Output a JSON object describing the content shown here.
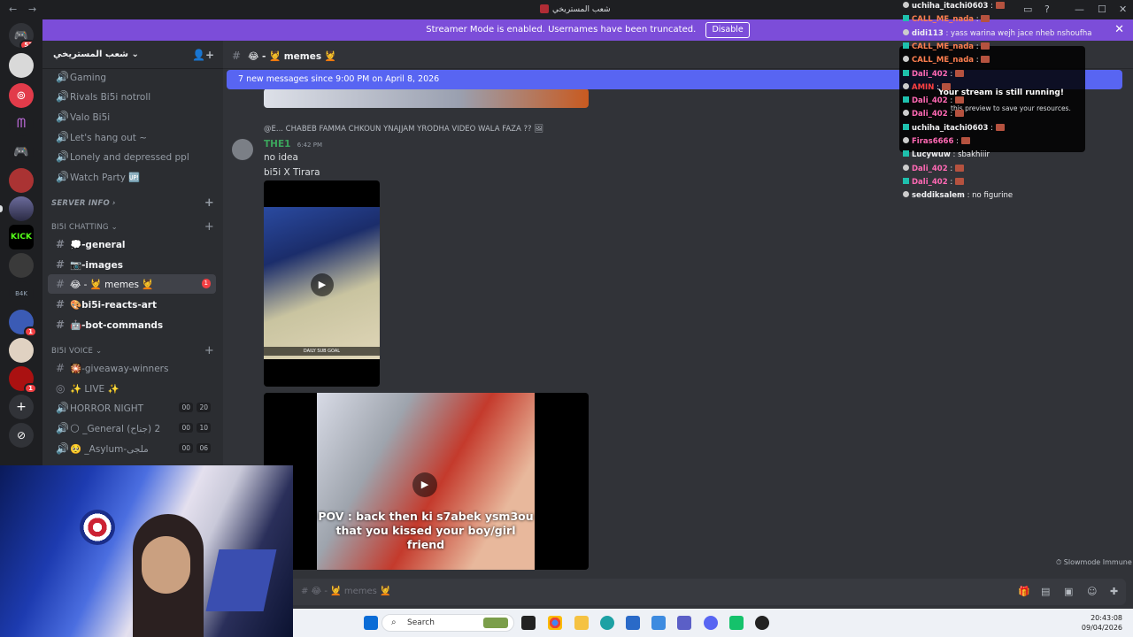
{
  "window": {
    "title": "شعب المستريخي"
  },
  "banner": {
    "text": "Streamer Mode is enabled. Usernames have been truncated.",
    "button": "Disable"
  },
  "rail": {
    "dm_badge": "52",
    "badges": [
      "1",
      "1"
    ]
  },
  "server": {
    "name": "شعب المستريخي"
  },
  "channels_top": [
    "Gaming",
    "Rivals Bi5i notroll",
    "Valo Bi5i",
    "Let's hang out ~",
    "Lonely and depressed ppl",
    "Watch Party 🆙"
  ],
  "categories": {
    "server_info": "SERVER INFO",
    "chatting": "BI5I CHATTING",
    "voice": "BI5I VOICE"
  },
  "chatting_channels": [
    {
      "label": "💭-general"
    },
    {
      "label": "📷-images"
    },
    {
      "label": "😂 - 💆 memes 💆",
      "badge": "1"
    },
    {
      "label": "🎨bi5i-reacts-art"
    },
    {
      "label": "🤖-bot-commands"
    }
  ],
  "voice_channels": [
    {
      "label": "🎇-giveaway-winners"
    },
    {
      "label": "✨ LIVE ✨"
    },
    {
      "label": "HORROR NIGHT",
      "c1": "00",
      "c2": "20"
    },
    {
      "label": "🌕 _General (جناح) 2",
      "c1": "00",
      "c2": "10"
    },
    {
      "label": "🥺 _Asylum-ملجى",
      "c1": "00",
      "c2": "06"
    }
  ],
  "channel_header": {
    "name": "😂 - 💆 memes 💆"
  },
  "new_messages": "7 new messages since 9:00 PM on April 8, 2026",
  "reply": {
    "text": "@E... CHABEB FAMMA CHKOUN YNAJJAM YRODHA VIDEO WALA FAZA ??"
  },
  "message": {
    "author": "THE1",
    "time": "6:42 PM",
    "line1": "no idea",
    "line2": "bi5i X Tirara"
  },
  "video1": {
    "caption": "DAILY SUB GOAL"
  },
  "video2": {
    "caption": "POV : back then ki s7abek ysm3ou that you kissed your boy/girl friend"
  },
  "slowmode": "Slowmode Immune",
  "composer": {
    "placeholder": "# 😂 - 💆 memes 💆"
  },
  "twitch_chat": [
    {
      "user": "uchiha_itachi0603",
      "msg": "",
      "color": "#efeff1"
    },
    {
      "user": "CALL_ME_nada",
      "msg": "",
      "color": "#ff7f50"
    },
    {
      "user": "didi113",
      "msg": "yass warina wejh jace nheb nshoufha",
      "color": "#efeff1"
    },
    {
      "user": "CALL_ME_nada",
      "msg": "",
      "color": "#ff7f50"
    },
    {
      "user": "CALL_ME_nada",
      "msg": "",
      "color": "#ff7f50"
    },
    {
      "user": "Dali_402",
      "msg": "",
      "color": "#ff69b4"
    },
    {
      "user": "AMIN",
      "msg": "",
      "color": "#ff4040"
    },
    {
      "user": "Dali_402",
      "msg": "",
      "color": "#ff69b4"
    },
    {
      "user": "Dali_402",
      "msg": "",
      "color": "#ff69b4"
    },
    {
      "user": "uchiha_itachi0603",
      "msg": "",
      "color": "#efeff1"
    },
    {
      "user": "Firas6666",
      "msg": "",
      "color": "#ff69b4"
    },
    {
      "user": "Lucywuw",
      "msg": "sbakhiiir",
      "color": "#efeff1"
    },
    {
      "user": "Dali_402",
      "msg": "",
      "color": "#ff69b4"
    },
    {
      "user": "Dali_402",
      "msg": "",
      "color": "#ff69b4"
    },
    {
      "user": "seddiksalem",
      "msg": "no figurine",
      "color": "#efeff1"
    }
  ],
  "stream_popup": {
    "title": "Your stream is still running!",
    "sub": "this preview to save your resources."
  },
  "taskbar": {
    "search": "Search",
    "time": "20:43:08",
    "date": "09/04/2026"
  }
}
